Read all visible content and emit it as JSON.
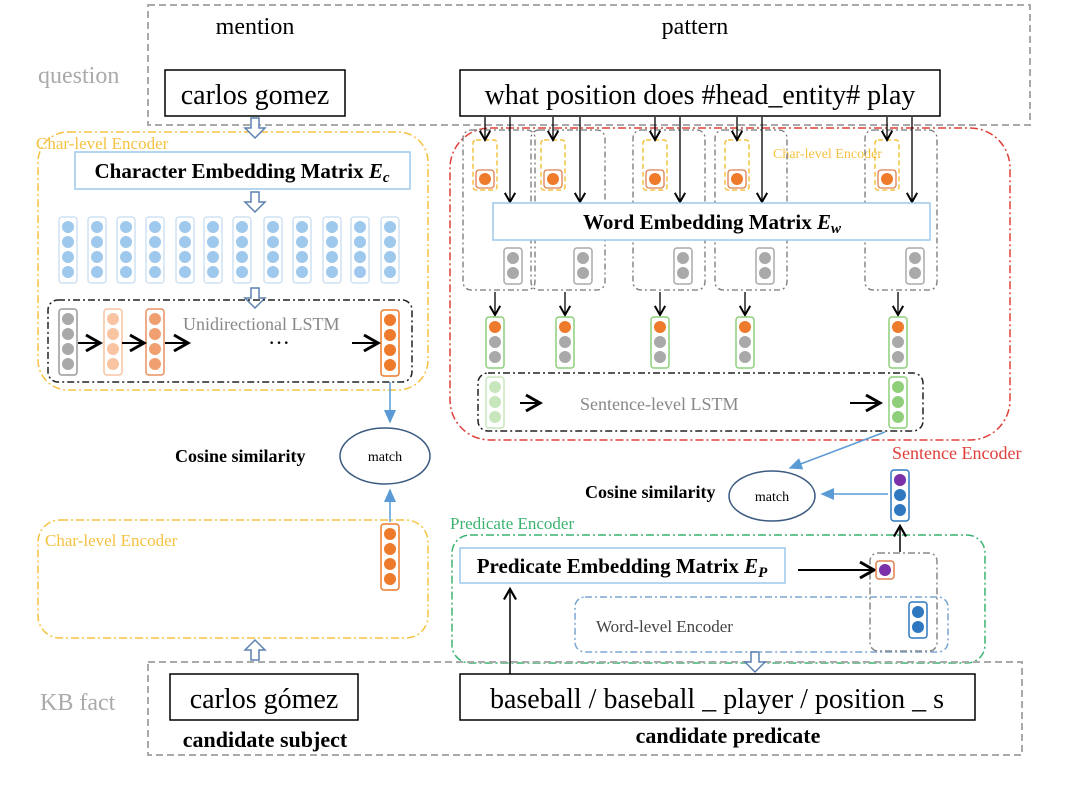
{
  "question_label": "question",
  "kb_fact_label": "KB fact",
  "mention": {
    "label": "mention",
    "text": "carlos gomez"
  },
  "pattern": {
    "label": "pattern",
    "text": "what position does #head_entity# play"
  },
  "char_encoder": {
    "label": "Char-level Encoder",
    "embedding_matrix": "Character Embedding Matrix ",
    "embedding_symbol": "E",
    "embedding_sub": "c",
    "lstm_label": "Unidirectional LSTM",
    "ellipsis": "···"
  },
  "sentence_encoder": {
    "label": "Sentence Encoder",
    "inner_char_label": "Char-level Encoder",
    "embedding_matrix": "Word Embedding Matrix ",
    "embedding_symbol": "E",
    "embedding_sub": "w",
    "lstm_label": "Sentence-level LSTM"
  },
  "match_left": {
    "similarity_label": "Cosine similarity",
    "node": "match"
  },
  "match_right": {
    "similarity_label": "Cosine similarity",
    "node": "match"
  },
  "lower_char_encoder": {
    "label": "Char-level Encoder"
  },
  "predicate_encoder": {
    "label": "Predicate Encoder",
    "embedding_matrix": "Predicate Embedding Matrix ",
    "embedding_symbol": "E",
    "embedding_sub": "P",
    "word_level_label": "Word-level Encoder"
  },
  "candidate_subject": {
    "text": "carlos gómez",
    "label": "candidate subject"
  },
  "candidate_predicate": {
    "text": "baseball / baseball _ player / position _ s",
    "label": "candidate predicate"
  },
  "colors": {
    "char_encoder": "#f5c242",
    "sentence_encoder": "#e0403a",
    "predicate_encoder": "#3cb371",
    "embedding_blue": "#9ec8ec",
    "orange": "#ee7b2c",
    "gray_node": "#a9a9a9",
    "green_node": "#8fcf7a",
    "purple_node": "#7b2fa8",
    "blue_node": "#2f78c0"
  }
}
